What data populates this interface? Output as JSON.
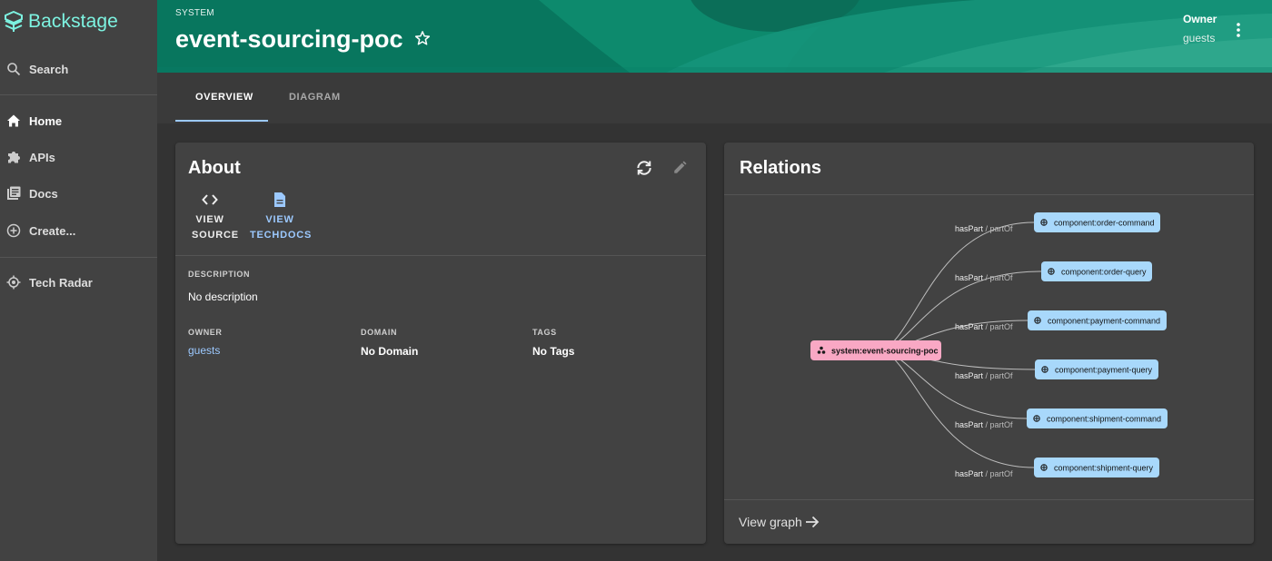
{
  "sidebar": {
    "logo_text": "Backstage",
    "items": [
      {
        "label": "Search",
        "icon": "search-icon"
      },
      {
        "label": "Home",
        "icon": "home-icon"
      },
      {
        "label": "APIs",
        "icon": "puzzle-icon"
      },
      {
        "label": "Docs",
        "icon": "library-books-icon"
      },
      {
        "label": "Create...",
        "icon": "add-circle-icon"
      },
      {
        "label": "Tech Radar",
        "icon": "radar-icon"
      }
    ]
  },
  "header": {
    "kind": "SYSTEM",
    "title": "event-sourcing-poc",
    "owner_label": "Owner",
    "owner_value": "guests"
  },
  "tabs": [
    {
      "label": "OVERVIEW",
      "active": true
    },
    {
      "label": "DIAGRAM",
      "active": false
    }
  ],
  "about": {
    "title": "About",
    "view_source_l1": "VIEW",
    "view_source_l2": "SOURCE",
    "view_techdocs_l1": "VIEW",
    "view_techdocs_l2": "TECHDOCS",
    "description_label": "DESCRIPTION",
    "description_value": "No description",
    "owner_label": "OWNER",
    "owner_value": "guests",
    "domain_label": "DOMAIN",
    "domain_value": "No Domain",
    "tags_label": "TAGS",
    "tags_value": "No Tags"
  },
  "relations": {
    "title": "Relations",
    "root": "system:event-sourcing-poc",
    "edge_label_main": "hasPart",
    "edge_label_sep": " / ",
    "edge_label_rev": "partOf",
    "nodes": [
      "component:order-command",
      "component:order-query",
      "component:payment-command",
      "component:payment-query",
      "component:shipment-command",
      "component:shipment-query"
    ],
    "view_graph": "View graph"
  },
  "colors": {
    "accent": "#7df3e1",
    "header_bg": "#0a7f66",
    "root_node": "#f9a8c4",
    "component_node": "#a8d8fb",
    "link": "#9cc9ff"
  }
}
